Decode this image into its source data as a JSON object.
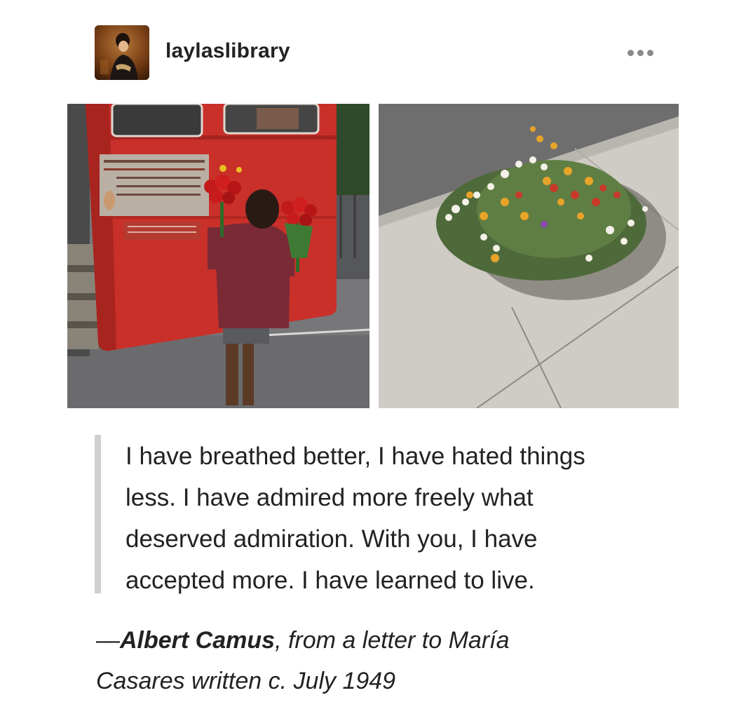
{
  "post": {
    "username": "laylaslibrary",
    "more_icon": "more-horizontal-icon",
    "quote": {
      "lines": [
        "I have breathed better, I have hated things",
        "less. I have admired more freely what",
        "deserved admiration. With you, I have",
        "accepted more. I have learned to live."
      ]
    },
    "attribution": {
      "dash": "—",
      "author": "Albert Camus",
      "comma": ",",
      "source_line_1": " from a letter to María",
      "source_line_2": "Casares written c. July 1949"
    },
    "images": [
      {
        "name": "boy-with-roses-by-red-bus-photo"
      },
      {
        "name": "flowers-growing-in-sidewalk-photo"
      }
    ]
  },
  "colors": {
    "bus_red": "#c9302a",
    "quote_bar": "#cfcfcf",
    "text": "#222222"
  }
}
